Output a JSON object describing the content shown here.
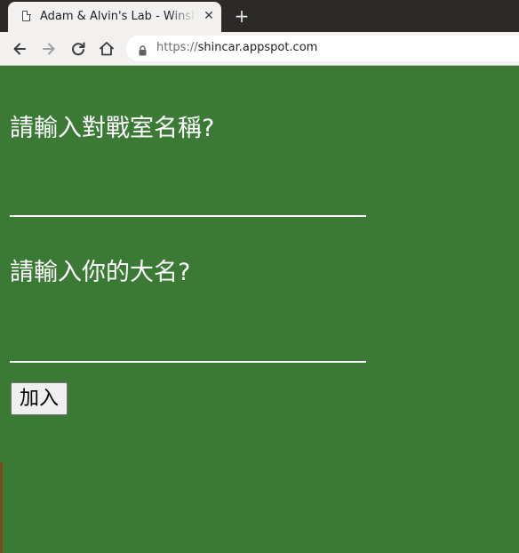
{
  "browser": {
    "tab": {
      "title": "Adam & Alvin's Lab - Winsh",
      "close_glyph": "✕",
      "favicon": "document-icon"
    },
    "new_tab_glyph": "+",
    "toolbar": {
      "back_icon": "back-arrow-icon",
      "forward_icon": "forward-arrow-icon",
      "reload_icon": "reload-icon",
      "home_icon": "home-icon",
      "lock_icon": "lock-icon"
    },
    "url": {
      "protocol": "https://",
      "host": "shincar.appspot.com"
    }
  },
  "page": {
    "background_color": "#3a7a35",
    "room_prompt": "請輸入對戰室名稱?",
    "room_input_value": "",
    "name_prompt": "請輸入你的大名?",
    "name_input_value": "",
    "join_button_label": "加入"
  }
}
